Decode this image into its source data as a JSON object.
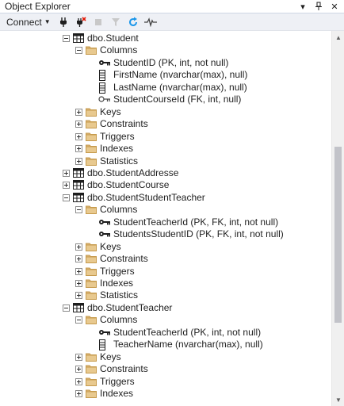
{
  "window": {
    "title": "Object Explorer",
    "pin_glyph": "⊕",
    "dropdown_glyph": "▾",
    "close_glyph": "✕"
  },
  "toolbar": {
    "connect_label": "Connect",
    "icons": [
      "connect-plug-icon",
      "disconnect-icon",
      "stop-icon",
      "filter-icon",
      "refresh-icon",
      "activity-monitor-icon"
    ]
  },
  "tree": {
    "rows": [
      {
        "label": "dbo.Student",
        "icon": "table-icon",
        "expander": "minus",
        "level": 0
      },
      {
        "label": "Columns",
        "icon": "folder-icon",
        "expander": "minus",
        "level": 1
      },
      {
        "label": "StudentID (PK, int, not null)",
        "icon": "primary-key-icon",
        "expander": "none",
        "level": 2
      },
      {
        "label": "FirstName (nvarchar(max), null)",
        "icon": "column-icon",
        "expander": "none",
        "level": 2
      },
      {
        "label": "LastName (nvarchar(max), null)",
        "icon": "column-icon",
        "expander": "none",
        "level": 2
      },
      {
        "label": "StudentCourseId (FK, int, null)",
        "icon": "foreign-key-icon",
        "expander": "none",
        "level": 2
      },
      {
        "label": "Keys",
        "icon": "folder-icon",
        "expander": "plus",
        "level": 1
      },
      {
        "label": "Constraints",
        "icon": "folder-icon",
        "expander": "plus",
        "level": 1
      },
      {
        "label": "Triggers",
        "icon": "folder-icon",
        "expander": "plus",
        "level": 1
      },
      {
        "label": "Indexes",
        "icon": "folder-icon",
        "expander": "plus",
        "level": 1
      },
      {
        "label": "Statistics",
        "icon": "folder-icon",
        "expander": "plus",
        "level": 1
      },
      {
        "label": "dbo.StudentAddresse",
        "icon": "table-icon",
        "expander": "plus",
        "level": 0
      },
      {
        "label": "dbo.StudentCourse",
        "icon": "table-icon",
        "expander": "plus",
        "level": 0
      },
      {
        "label": "dbo.StudentStudentTeacher",
        "icon": "table-icon",
        "expander": "minus",
        "level": 0
      },
      {
        "label": "Columns",
        "icon": "folder-icon",
        "expander": "minus",
        "level": 1
      },
      {
        "label": "StudentTeacherId (PK, FK, int, not null)",
        "icon": "primary-key-icon",
        "expander": "none",
        "level": 2
      },
      {
        "label": "StudentsStudentID (PK, FK, int, not null)",
        "icon": "primary-key-icon",
        "expander": "none",
        "level": 2
      },
      {
        "label": "Keys",
        "icon": "folder-icon",
        "expander": "plus",
        "level": 1
      },
      {
        "label": "Constraints",
        "icon": "folder-icon",
        "expander": "plus",
        "level": 1
      },
      {
        "label": "Triggers",
        "icon": "folder-icon",
        "expander": "plus",
        "level": 1
      },
      {
        "label": "Indexes",
        "icon": "folder-icon",
        "expander": "plus",
        "level": 1
      },
      {
        "label": "Statistics",
        "icon": "folder-icon",
        "expander": "plus",
        "level": 1
      },
      {
        "label": "dbo.StudentTeacher",
        "icon": "table-icon",
        "expander": "minus",
        "level": 0
      },
      {
        "label": "Columns",
        "icon": "folder-icon",
        "expander": "minus",
        "level": 1
      },
      {
        "label": "StudentTeacherId (PK, int, not null)",
        "icon": "primary-key-icon",
        "expander": "none",
        "level": 2
      },
      {
        "label": "TeacherName (nvarchar(max), null)",
        "icon": "column-icon",
        "expander": "none",
        "level": 2
      },
      {
        "label": "Keys",
        "icon": "folder-icon",
        "expander": "plus",
        "level": 1
      },
      {
        "label": "Constraints",
        "icon": "folder-icon",
        "expander": "plus",
        "level": 1
      },
      {
        "label": "Triggers",
        "icon": "folder-icon",
        "expander": "plus",
        "level": 1
      },
      {
        "label": "Indexes",
        "icon": "folder-icon",
        "expander": "plus",
        "level": 1
      }
    ]
  },
  "colors": {
    "folder": "#dcb67a",
    "table": "#1e1e1e",
    "accent": "#1c97ea",
    "key": "#1e1e1e"
  }
}
